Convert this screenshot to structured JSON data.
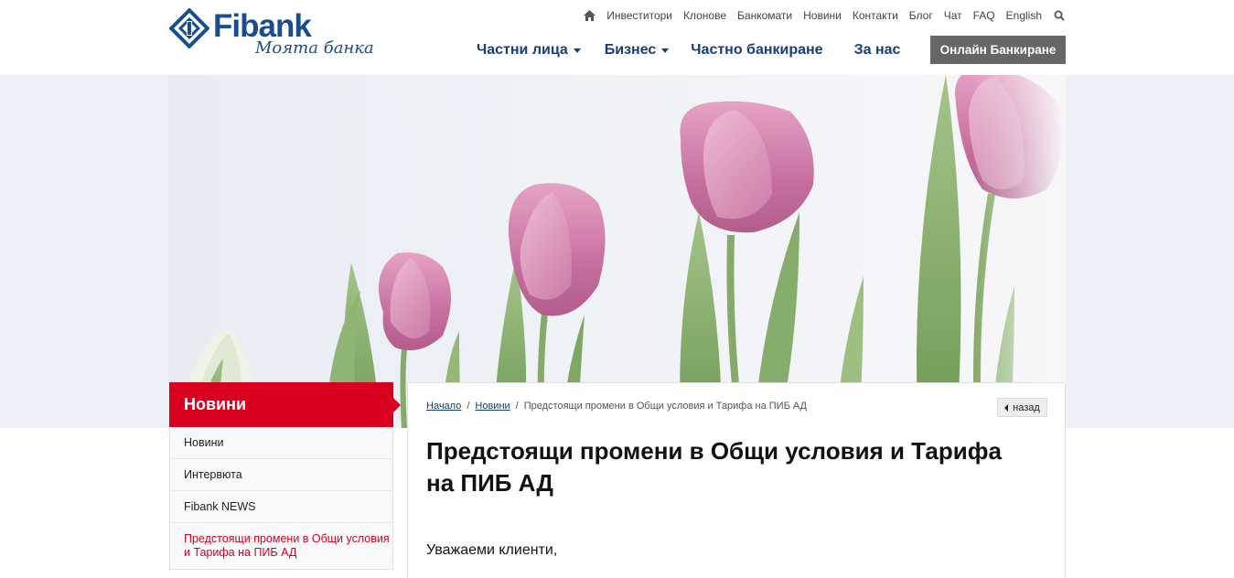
{
  "brand": {
    "name": "Fibank",
    "tagline": "Моята банка",
    "colors": {
      "primary": "#1a4d8f",
      "accent": "#d9001f",
      "online_bg": "#666666"
    }
  },
  "top_links": {
    "home_icon": "home-icon",
    "items": [
      "Инвеститори",
      "Клонове",
      "Банкомати",
      "Новини",
      "Контакти",
      "Блог",
      "Чат",
      "FAQ",
      "English"
    ],
    "search_icon": "search-icon"
  },
  "main_nav": {
    "items": [
      {
        "label": "Частни лица",
        "dropdown": true
      },
      {
        "label": "Бизнес",
        "dropdown": true
      },
      {
        "label": "Частно банкиране",
        "dropdown": false
      },
      {
        "label": "За нас",
        "dropdown": false
      }
    ],
    "online_button": "Онлайн Банкиране"
  },
  "sidebar": {
    "title": "Новини",
    "items": [
      {
        "label": "Новини",
        "active": false
      },
      {
        "label": "Интервюта",
        "active": false
      },
      {
        "label": "Fibank NEWS",
        "active": false
      },
      {
        "label": "Предстоящи промени в Общи условия и Тарифа на ПИБ АД",
        "active": true
      }
    ]
  },
  "content": {
    "breadcrumb": {
      "home": "Начало",
      "sep": "/",
      "section": "Новини",
      "current": "Предстоящи промени в Общи условия и Тарифа на ПИБ АД"
    },
    "back_label": "назад",
    "title": "Предстоящи промени в Общи условия и Тарифа на ПИБ АД",
    "greeting": "Уважаеми клиенти,"
  }
}
